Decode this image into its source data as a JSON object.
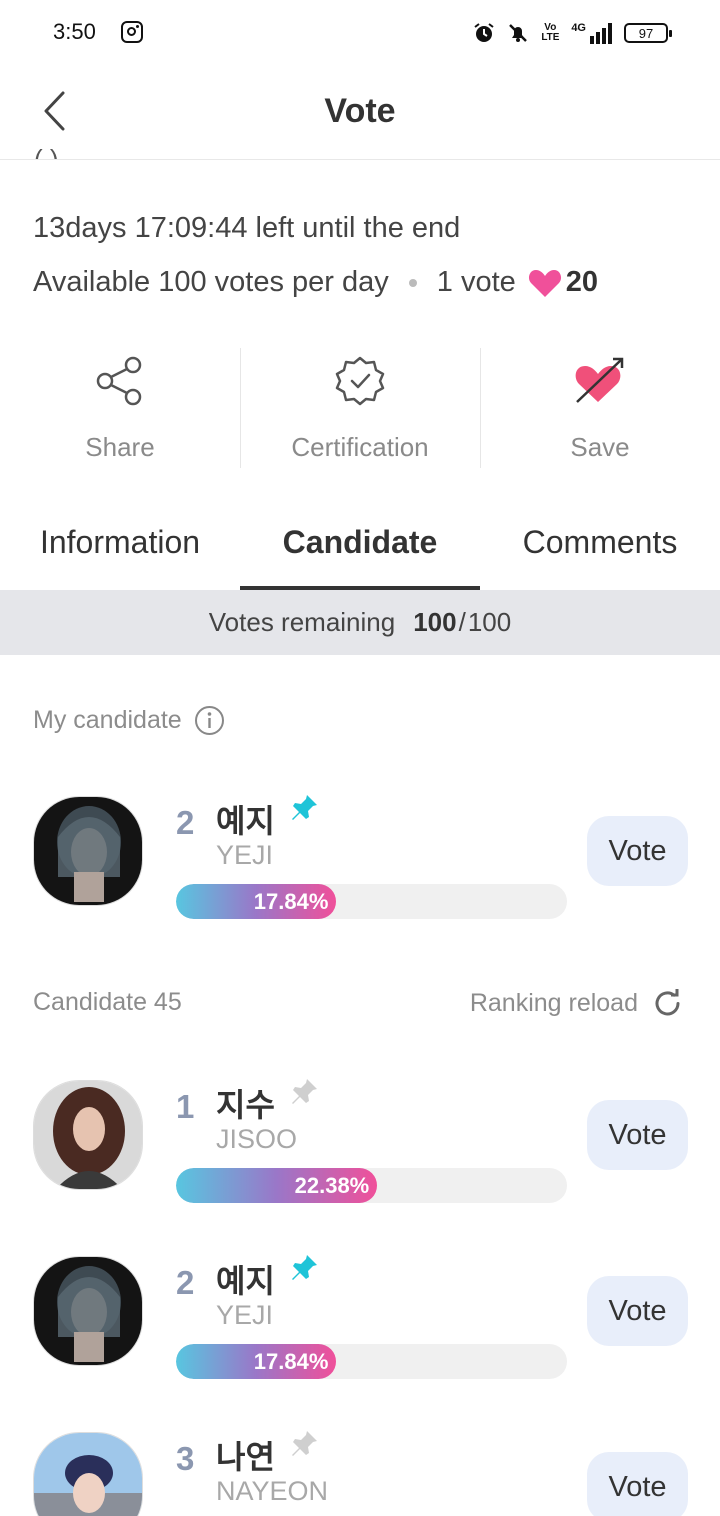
{
  "status_bar": {
    "time": "3:50",
    "battery": "97",
    "network": "4G",
    "lte": "Vo LTE"
  },
  "header": {
    "title": "Vote",
    "cutoff_text": "(          )"
  },
  "info": {
    "time_left": "13days 17:09:44 left until the end",
    "daily": "Available 100 votes per day",
    "per_vote": "1 vote",
    "heart_count": "20"
  },
  "actions": [
    {
      "label": "Share",
      "icon": "share-icon"
    },
    {
      "label": "Certification",
      "icon": "certification-badge-icon"
    },
    {
      "label": "Save",
      "icon": "heart-arrow-icon"
    }
  ],
  "tabs": [
    {
      "label": "Information",
      "active": false
    },
    {
      "label": "Candidate",
      "active": true
    },
    {
      "label": "Comments",
      "active": false
    }
  ],
  "votes_remaining": {
    "label": "Votes remaining",
    "value": "100",
    "total": "100"
  },
  "my_candidate": {
    "label": "My candidate",
    "rank": "2",
    "name_kr": "예지",
    "name_en": "YEJI",
    "percent_label": "17.84%",
    "percent": 17.84,
    "pinned": true,
    "vote_label": "Vote"
  },
  "candidates_header": {
    "label": "Candidate 45",
    "reload_label": "Ranking reload"
  },
  "candidates": [
    {
      "rank": "1",
      "name_kr": "지수",
      "name_en": "JISOO",
      "percent_label": "22.38%",
      "percent": 22.38,
      "pinned": false,
      "vote_label": "Vote"
    },
    {
      "rank": "2",
      "name_kr": "예지",
      "name_en": "YEJI",
      "percent_label": "17.84%",
      "percent": 17.84,
      "pinned": true,
      "vote_label": "Vote"
    },
    {
      "rank": "3",
      "name_kr": "나연",
      "name_en": "NAYEON",
      "percent_label": "",
      "percent": 0,
      "pinned": false,
      "vote_label": "Vote"
    }
  ],
  "colors": {
    "accent_pink": "#f0509a",
    "accent_cyan": "#1fc4d8",
    "vote_button_bg": "#e8eefa"
  }
}
